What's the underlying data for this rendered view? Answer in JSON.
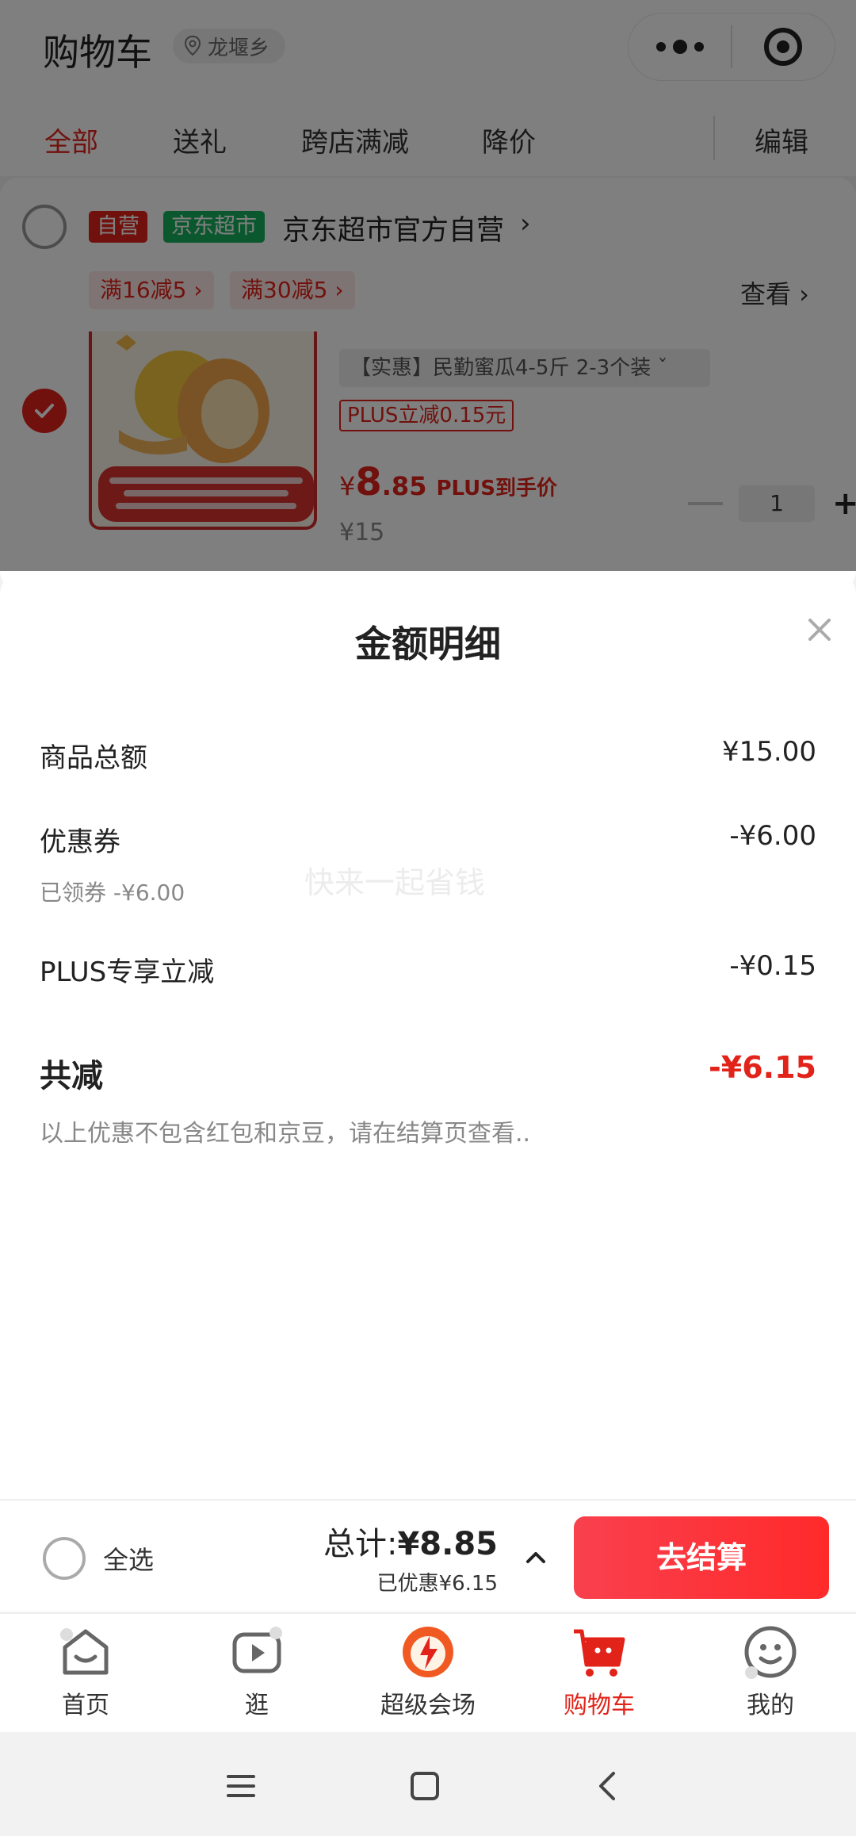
{
  "header": {
    "title": "购物车",
    "location": "龙堰乡"
  },
  "tabs": [
    "全部",
    "送礼",
    "跨店满减",
    "降价"
  ],
  "edit_label": "编辑",
  "shop": {
    "tag_self": "自营",
    "tag_market": "京东超市",
    "name": "京东超市官方自营",
    "arrow": "›",
    "promos": [
      "满16减5 ›",
      "满30减5 ›"
    ],
    "view_label": "查看 ›"
  },
  "product": {
    "spec": "【实惠】民勤蜜瓜4-5斤 2-3个装  ˇ",
    "plus_badge": "PLUS立减0.15元",
    "price_symbol": "¥",
    "price_int": "8",
    "price_dec": ".85",
    "plus_price_label": "PLUS到手价",
    "original_price": "¥15",
    "quantity": "1",
    "plus_symbol": "+"
  },
  "sheet": {
    "title": "金额明细",
    "rows": [
      {
        "label": "商品总额",
        "value": "¥15.00"
      },
      {
        "label": "优惠券",
        "value": "-¥6.00",
        "sub": "已领券 -¥6.00"
      },
      {
        "label": "PLUS专享立减",
        "value": "-¥0.15"
      }
    ],
    "watermark": "快来一起省钱",
    "total_label": "共减",
    "total_value": "-¥6.15",
    "note": "以上优惠不包含红包和京豆，请在结算页查看.."
  },
  "checkout": {
    "select_all": "全选",
    "total_label": "总计:",
    "total_value": "¥8.85",
    "saved": "已优惠¥6.15",
    "button": "去结算"
  },
  "nav": [
    {
      "label": "首页",
      "icon": "home-icon"
    },
    {
      "label": "逛",
      "icon": "video-icon"
    },
    {
      "label": "超级会场",
      "icon": "super-venue-icon"
    },
    {
      "label": "购物车",
      "icon": "cart-icon",
      "active": true
    },
    {
      "label": "我的",
      "icon": "profile-icon"
    }
  ],
  "colors": {
    "accent": "#e2231a",
    "green_tag": "#16b05f",
    "button_start": "#f9404e",
    "button_end": "#ff2a2a"
  }
}
